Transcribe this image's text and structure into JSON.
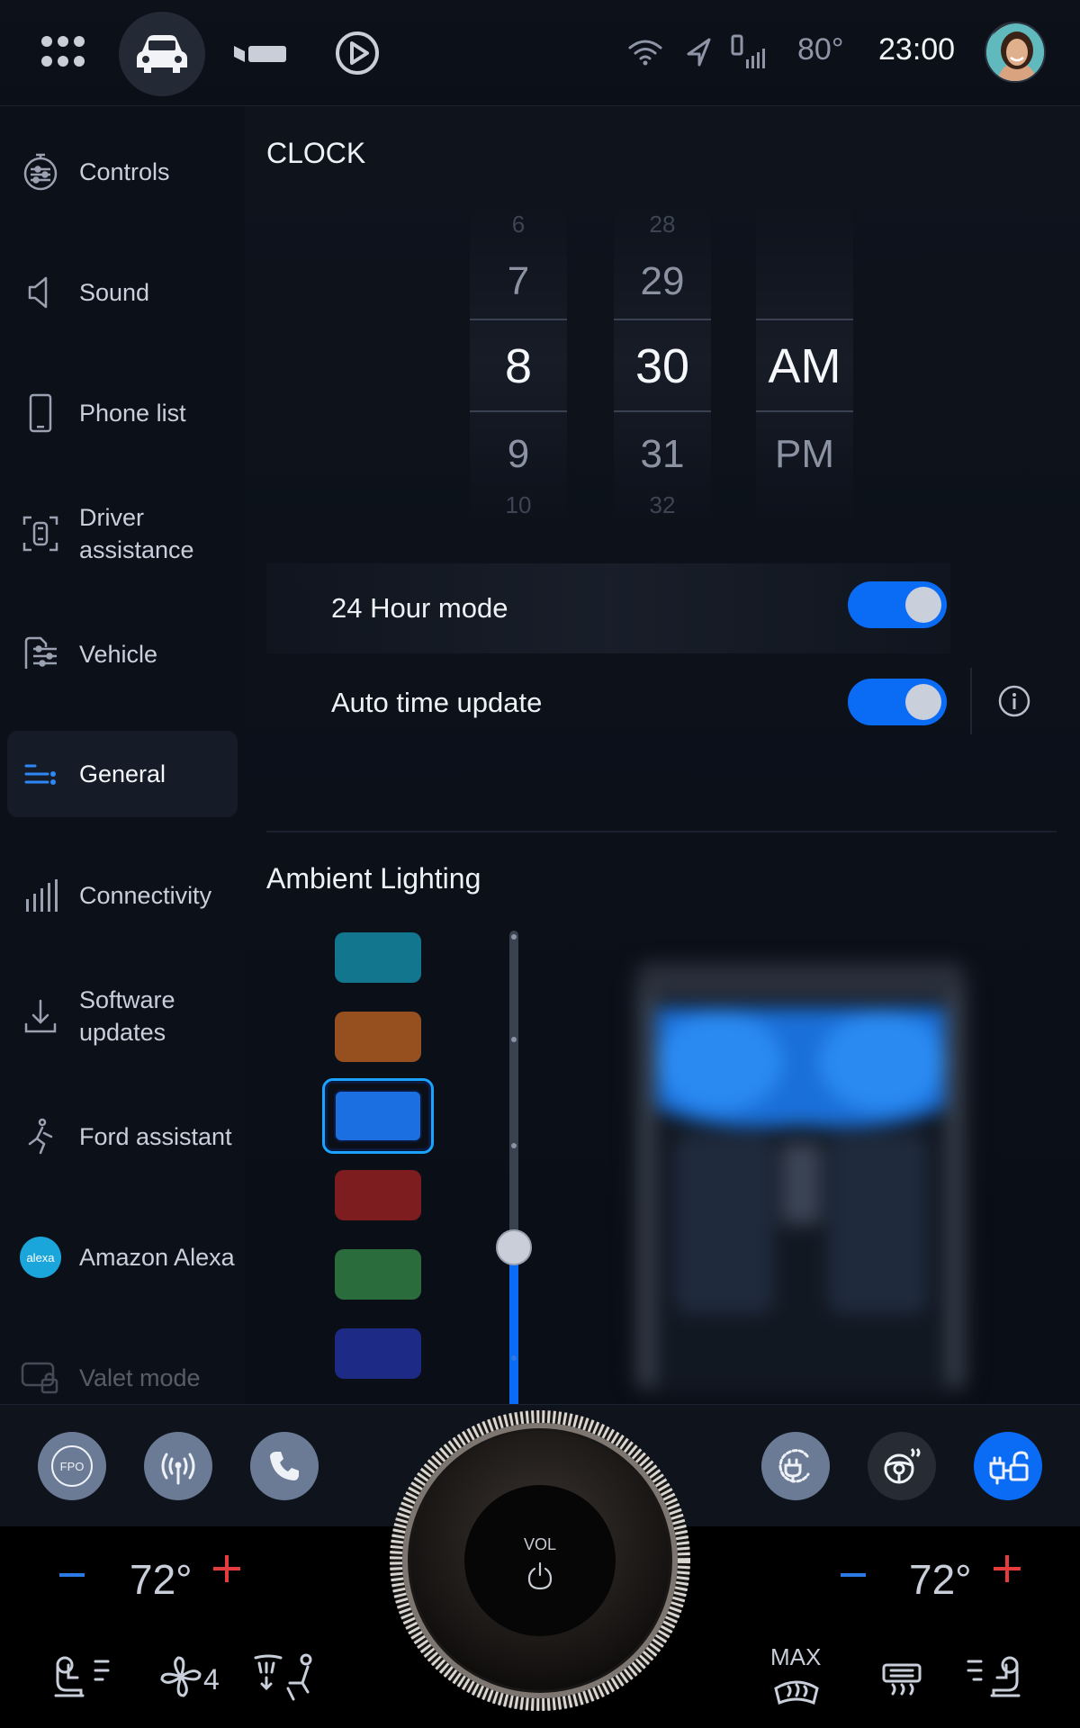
{
  "topbar": {
    "icons": [
      "apps-grid-icon",
      "car-icon",
      "seat-recline-icon",
      "play-circle-icon"
    ],
    "status_icons": [
      "wifi-icon",
      "navigation-arrow-icon",
      "phone-signal-icon"
    ],
    "outside_temp": "80°",
    "time": "23:00"
  },
  "sidebar": {
    "items": [
      {
        "label": "Controls",
        "icon": "controls-icon"
      },
      {
        "label": "Sound",
        "icon": "speaker-icon"
      },
      {
        "label": "Phone list",
        "icon": "phone-icon"
      },
      {
        "label": "Driver\nassistance",
        "icon": "driver-assist-icon"
      },
      {
        "label": "Vehicle",
        "icon": "vehicle-settings-icon"
      },
      {
        "label": "General",
        "icon": "general-list-icon",
        "active": true
      },
      {
        "label": "Connectivity",
        "icon": "signal-bars-icon"
      },
      {
        "label": "Software\nupdates",
        "icon": "download-icon"
      },
      {
        "label": "Ford assistant",
        "icon": "assistant-icon"
      },
      {
        "label": "Amazon Alexa",
        "icon": "alexa-icon",
        "icon_text": "alexa"
      },
      {
        "label": "Valet mode",
        "icon": "valet-lock-icon",
        "disabled": true
      }
    ]
  },
  "clock": {
    "title": "CLOCK",
    "hours": {
      "above2": "6",
      "above1": "7",
      "selected": "8",
      "below1": "9",
      "below2": "10"
    },
    "minutes": {
      "above2": "28",
      "above1": "29",
      "selected": "30",
      "below1": "31",
      "below2": "32"
    },
    "ampm": {
      "selected": "AM",
      "below1": "PM"
    },
    "hour_mode_label": "24 Hour mode",
    "hour_mode_on": true,
    "auto_time_label": "Auto time update",
    "auto_time_on": true
  },
  "ambient": {
    "title": "Ambient Lighting",
    "colors": [
      "#13768f",
      "#96501f",
      "#1c6fe0",
      "#7e1d1f",
      "#2b6c3d",
      "#1d2a86"
    ],
    "selected_index": 2,
    "brightness_fraction": 0.33
  },
  "dock": {
    "left_buttons": [
      {
        "name": "fpo-button",
        "label": "FPO"
      },
      {
        "name": "radio-button",
        "icon": "antenna-icon"
      },
      {
        "name": "phone-button",
        "icon": "phone-handset-icon"
      }
    ],
    "right_buttons": [
      {
        "name": "charge-button",
        "icon": "plug-icon"
      },
      {
        "name": "heated-wheel-button",
        "icon": "heated-steering-icon"
      },
      {
        "name": "power-outlet-button",
        "icon": "pro-power-icon",
        "active": true
      }
    ]
  },
  "climate": {
    "left_temp": "72°",
    "right_temp": "72°",
    "fan_speed": "4",
    "max_label": "MAX",
    "vol_label": "VOL"
  }
}
